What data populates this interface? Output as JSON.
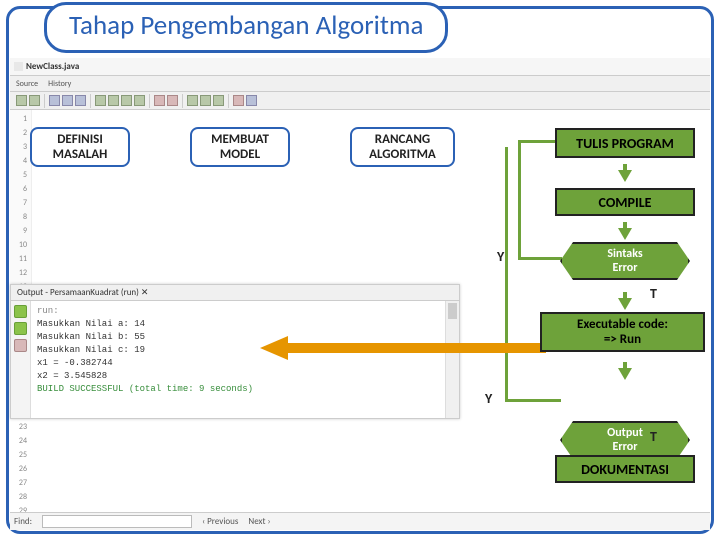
{
  "title": "Tahap Pengembangan Algoritma",
  "ide": {
    "file_tab": "NewClass.java",
    "sub_source": "Source",
    "sub_history": "History",
    "output_title": "Output - PersamaanKuadrat (run)  ✕",
    "output_lines": {
      "run": "run:",
      "a": "Masukkan Nilai a: 14",
      "b": "Masukkan Nilai b: 55",
      "c": "Masukkan Nilai c: 19",
      "x1": "x1 = -0.382744",
      "x2": "x2 =   3.545828",
      "build": "BUILD SUCCESSFUL (total time: 9 seconds)"
    },
    "find_label": "Find:",
    "prev": "‹ Previous",
    "next": "Next ›"
  },
  "flow": {
    "definisi": "DEFINISI\nMASALAH",
    "membuat": "MEMBUAT\nMODEL",
    "rancang": "RANCANG\nALGORITMA",
    "tulis": "TULIS PROGRAM",
    "compile": "COMPILE",
    "sintaks": "Sintaks\nError",
    "exec": "Executable code:\n=> Run",
    "output_err": "Output\nError",
    "dokumentasi": "DOKUMENTASI",
    "y1": "Y",
    "y2": "Y",
    "t1": "T",
    "t2": "T"
  },
  "chart_data": {
    "type": "flowchart",
    "nodes": [
      {
        "id": "definisi",
        "label": "DEFINISI MASALAH",
        "shape": "rounded-rect"
      },
      {
        "id": "membuat",
        "label": "MEMBUAT MODEL",
        "shape": "rounded-rect"
      },
      {
        "id": "rancang",
        "label": "RANCANG ALGORITMA",
        "shape": "rounded-rect"
      },
      {
        "id": "tulis",
        "label": "TULIS PROGRAM",
        "shape": "rect"
      },
      {
        "id": "compile",
        "label": "COMPILE",
        "shape": "rect"
      },
      {
        "id": "sintaks",
        "label": "Sintaks Error",
        "shape": "decision"
      },
      {
        "id": "exec",
        "label": "Executable code: => Run",
        "shape": "rect"
      },
      {
        "id": "output_err",
        "label": "Output Error",
        "shape": "decision"
      },
      {
        "id": "dokumentasi",
        "label": "DOKUMENTASI",
        "shape": "rect"
      }
    ],
    "edges": [
      {
        "from": "definisi",
        "to": "membuat"
      },
      {
        "from": "membuat",
        "to": "rancang"
      },
      {
        "from": "rancang",
        "to": "tulis"
      },
      {
        "from": "tulis",
        "to": "compile"
      },
      {
        "from": "compile",
        "to": "sintaks"
      },
      {
        "from": "sintaks",
        "to": "tulis",
        "label": "Y"
      },
      {
        "from": "sintaks",
        "to": "exec",
        "label": "T"
      },
      {
        "from": "exec",
        "to": "output_err"
      },
      {
        "from": "output_err",
        "to": "rancang",
        "label": "Y"
      },
      {
        "from": "output_err",
        "to": "dokumentasi",
        "label": "T"
      }
    ]
  }
}
